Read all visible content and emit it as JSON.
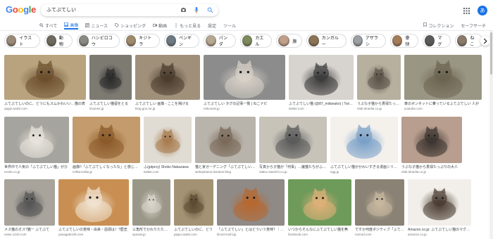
{
  "header": {
    "logo_letters": [
      {
        "ch": "G",
        "color": "#4285f4"
      },
      {
        "ch": "o",
        "color": "#ea4335"
      },
      {
        "ch": "o",
        "color": "#fbbc05"
      },
      {
        "ch": "g",
        "color": "#4285f4"
      },
      {
        "ch": "l",
        "color": "#34a853"
      },
      {
        "ch": "e",
        "color": "#ea4335"
      }
    ],
    "query": "ふてぶてしい",
    "avatar_letter": "あ"
  },
  "tabs": [
    {
      "label": "すべて",
      "icon": "search-icon"
    },
    {
      "label": "画像",
      "icon": "image-icon",
      "active": true
    },
    {
      "label": "ニュース",
      "icon": "news-icon"
    },
    {
      "label": "ショッピング",
      "icon": "tag-icon"
    },
    {
      "label": "動画",
      "icon": "video-icon"
    },
    {
      "label": "もっと見る",
      "icon": "more-icon"
    },
    {
      "label": "設定"
    },
    {
      "label": "ツール"
    }
  ],
  "tabs_right": [
    {
      "label": "コレクション",
      "icon": "bookmark-icon"
    },
    {
      "label": "セーフサーチ",
      "icon": "safesearch-icon"
    }
  ],
  "chips": [
    "イラスト",
    "動物",
    "ハシビロコウ",
    "キジトラ",
    "ペンギン",
    "パンダ",
    "カエル",
    "豚",
    "カンガルー",
    "アザラシ",
    "豪快",
    "マグ",
    "ねこ"
  ],
  "rows": [
    [
      {
        "caption": "ふてぶてしいのに、どうにもスムかわいい…猫の表",
        "source": "apppi.asahi.com",
        "color": "#b8a37e",
        "accent": "#6b4e2e"
      },
      {
        "caption": "ふてぶてしい猫寝をとる",
        "source": "lizarees.jp",
        "color": "#7d7a72",
        "accent": "#2c2c2c"
      },
      {
        "caption": "ふてぶてしい 画像 - ここを掲げる",
        "source": "blog.goo.ne.jp",
        "color": "#a0907a",
        "accent": "#4a3c2d"
      },
      {
        "caption": "ふてぶてしい タグの記事一覧 | ねこナビ",
        "source": "nekonavi.jp",
        "color": "#8c8c8c",
        "accent": "#d8d2c8"
      },
      {
        "caption": "ふてぶてしい猫 (@87_miilanako) | Twitter",
        "source": "twitter.com",
        "color": "#d7d4cf",
        "accent": "#3a3a3a"
      },
      {
        "caption": "うぶな子猫から貫禄たっぷり",
        "source": "nlab.itmedia.co.jp",
        "color": "#b7b09f",
        "accent": "#5c5448"
      },
      {
        "caption": "車のボンネットに乗っているふてぶてしい 人が",
        "source": "youtube.com",
        "color": "#9a9684",
        "accent": "#6b6450"
      }
    ],
    [
      {
        "caption": "世界中で人気の「ふてぶてしい猫」がひ",
        "source": "excite.co.jp",
        "color": "#a6a49e",
        "accent": "#e8e4dc"
      },
      {
        "caption": "画像!!「ふてぶてしくなったな」と感じる猫",
        "source": "millioncollar.jp",
        "color": "#c49b6c",
        "accent": "#8a5a2a"
      },
      {
        "caption": "ふ(gdprcy) Shoko Nakazawa",
        "source": "twitter.com",
        "color": "#e0dcd4",
        "accent": "#a87c4e"
      },
      {
        "caption": "猫と家ガーデニング「ふてぶてしい猫」の描",
        "source": "webspharna.livedoor.blog",
        "color": "#b9b4ab",
        "accent": "#7a6a5a"
      },
      {
        "caption": "写真から子猫が「何事」…魔猫たちがふてぶてし",
        "source": "otaku.mainichi.co.jp",
        "color": "#c7c3b9",
        "accent": "#5a5a5a"
      },
      {
        "caption": "ふてぶてしい猫がかわいすぎる漫画シリーズ「?猫」ツ",
        "source": "egg.jp",
        "color": "#f4f1ec",
        "accent": "#7aa0c8"
      },
      {
        "caption": "うぶな子猫から貫禄たっぷりの大人",
        "source": "nlab.itmedia.co.jp",
        "color": "#b89e8e",
        "accent": "#3c3430"
      }
    ],
    [
      {
        "caption": "メス猫のオス?猫ー ふてぶて",
        "source": "news.1242.com",
        "color": "#a8a39b",
        "accent": "#555"
      },
      {
        "caption": "ふてぶてしいの意味・由来・語源は！?歴史",
        "source": "yanagaki128.com",
        "color": "#c98f52",
        "accent": "#f1e3d1"
      },
      {
        "caption": "三角形でかわりたたえた",
        "source": "aywola.jp",
        "color": "#9b9788",
        "accent": "#d9d5cc"
      },
      {
        "caption": "ふてぶてしいのに、どう",
        "source": "pippo.asahi.com",
        "color": "#a39273",
        "accent": "#5e4a32"
      },
      {
        "caption": "「ふてぶてしい」とはどういう意味？｜ふてぶ",
        "source": "kinoei-toshi.jp",
        "color": "#8f8a86",
        "accent": "#b7682f"
      },
      {
        "caption": "いつからそんなにふてぶてしい猫を無",
        "source": "facebook.com",
        "color": "#6e9a5a",
        "accent": "#e0b078"
      },
      {
        "caption": "ですか何度ポジティブ「ふてぶてしい",
        "source": "nomod.com",
        "color": "#8a8274",
        "accent": "#c8b8a0"
      },
      {
        "caption": "Amazon.co.jp: ふてぶてしい猫のマグカップ",
        "source": "amazon.co.jp",
        "color": "#f2efea",
        "accent": "#4a3c32"
      }
    ]
  ]
}
